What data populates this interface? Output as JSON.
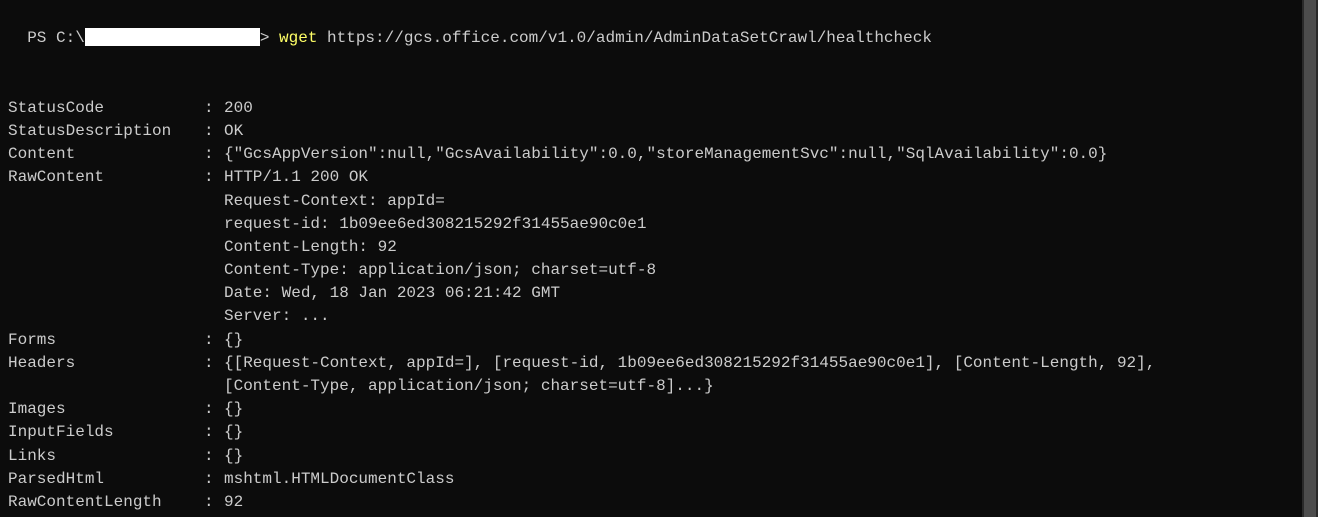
{
  "prompt": {
    "prefix": "PS C:\\",
    "suffix": "> ",
    "cmd_keyword": "wget",
    "cmd_arg": " https://gcs.office.com/v1.0/admin/AdminDataSetCrawl/healthcheck"
  },
  "output": {
    "sep": ":",
    "rows": [
      {
        "key": "StatusCode",
        "val": "200"
      },
      {
        "key": "StatusDescription",
        "val": "OK"
      },
      {
        "key": "Content",
        "val": "{\"GcsAppVersion\":null,\"GcsAvailability\":0.0,\"storeManagementSvc\":null,\"SqlAvailability\":0.0}"
      }
    ],
    "rawcontent": {
      "key": "RawContent",
      "first": "HTTP/1.1 200 OK",
      "lines": [
        "Request-Context: appId=",
        "request-id: 1b09ee6ed308215292f31455ae90c0e1",
        "Content-Length: 92",
        "Content-Type: application/json; charset=utf-8",
        "Date: Wed, 18 Jan 2023 06:21:42 GMT",
        "Server: ..."
      ]
    },
    "after": [
      {
        "key": "Forms",
        "val": "{}"
      }
    ],
    "headers": {
      "key": "Headers",
      "first": "{[Request-Context, appId=], [request-id, 1b09ee6ed308215292f31455ae90c0e1], [Content-Length, 92],",
      "cont": "[Content-Type, application/json; charset=utf-8]...}"
    },
    "final": [
      {
        "key": "Images",
        "val": "{}"
      },
      {
        "key": "InputFields",
        "val": "{}"
      },
      {
        "key": "Links",
        "val": "{}"
      },
      {
        "key": "ParsedHtml",
        "val": "mshtml.HTMLDocumentClass"
      },
      {
        "key": "RawContentLength",
        "val": "92"
      }
    ]
  }
}
